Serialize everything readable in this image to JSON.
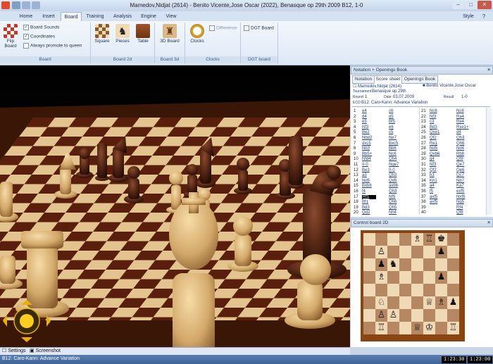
{
  "window": {
    "title": "Mamedov,Nidjat (2614) - Benito Vicente,Jose Oscar (2022), Benasque op 29th 2009  B12, 1-0"
  },
  "tabs": [
    "Home",
    "Insert",
    "Board",
    "Training",
    "Analysis",
    "Engine",
    "View"
  ],
  "active_tab": "Board",
  "style_label": "Style",
  "ribbon": {
    "flip_board": "Flip Board",
    "board_sounds": "Board Sounds",
    "coordinates": "Coordinates",
    "always_promote": "Always promote to queen",
    "group_board": "Board",
    "square": "Square",
    "pieces": "Pieces",
    "table": "Table",
    "group_board2d": "Board 2d",
    "board3d": "3D Board",
    "group_board3d": "Board 3d",
    "clocks": "Clocks",
    "difference": "Difference",
    "group_clocks": "Clocks",
    "dgt_board": "DGT Board",
    "group_dgt": "DGT board"
  },
  "notation_panel": {
    "title": "Notation + Openings Book",
    "subtabs": [
      "Notation",
      "Score sheet",
      "Openings Book"
    ],
    "active_subtab": "Score sheet",
    "white_player": "Mamedov,Nidjat (2614)",
    "black_player": "Benito Vicente,Jose Oscar",
    "tournament_label": "Tournament",
    "tournament": "Benasque op 29th",
    "round_label": "Round",
    "round": "1",
    "date_label": "Date",
    "date": "03.07.2009",
    "result_label": "Result",
    "result": "1-0",
    "eco_label": "ECO",
    "eco": "B12: Caro-Kann: Advance Variation",
    "moves_left": [
      [
        "1",
        "e4",
        "c6"
      ],
      [
        "2",
        "d4",
        "d5"
      ],
      [
        "3",
        "e5",
        "Bf5"
      ],
      [
        "4",
        "Nf3",
        "e6"
      ],
      [
        "5",
        "Be2",
        "c5"
      ],
      [
        "6",
        "Nbd2",
        "Ne7"
      ],
      [
        "7",
        "dxc5",
        "Bxc5"
      ],
      [
        "8",
        "Nb3",
        "Bb6"
      ],
      [
        "9",
        "Bb5+",
        "Nc6"
      ],
      [
        "10",
        "Nfd4",
        "Qh4"
      ],
      [
        "11",
        "0-0",
        "Nge7"
      ],
      [
        "12",
        "Be3",
        "0-0"
      ],
      [
        "13",
        "a3",
        "Qh3"
      ],
      [
        "14",
        "Nd5",
        "Qd5"
      ],
      [
        "15",
        "Bxb6",
        "axb6"
      ],
      [
        "16",
        "f4",
        "Qh3"
      ],
      [
        "17",
        "Rf1",
        "Nf5"
      ],
      [
        "18",
        "Bf1",
        "Qh6"
      ],
      [
        "19",
        "Bd3",
        "Qh5"
      ],
      [
        "20",
        "Qd2",
        "Nh4"
      ]
    ],
    "moves_right": [
      [
        "21",
        "Nc6",
        "Nc6"
      ],
      [
        "22",
        "Nf3",
        "Ra4"
      ],
      [
        "23",
        "c3",
        "Re4"
      ],
      [
        "24",
        "Bd3",
        "Rxe1+"
      ],
      [
        "25",
        "Qxe1",
        "d4"
      ],
      [
        "26",
        "Qf2",
        "Qh3"
      ],
      [
        "27",
        "Re1",
        "Qh6"
      ],
      [
        "28",
        "Nd5",
        "Nd4"
      ],
      [
        "29",
        "Qxb6",
        "Rb8"
      ],
      [
        "30",
        "g4",
        "Qf8"
      ],
      [
        "31",
        "Nf3",
        "Qe7"
      ],
      [
        "32",
        "Qf2",
        "Qe6"
      ],
      [
        "33",
        "h3",
        "Qc7"
      ],
      [
        "34",
        "Kh1",
        "Nb7"
      ],
      [
        "35",
        "a4",
        "Ka7"
      ],
      [
        "36",
        "f5",
        "exf5"
      ],
      [
        "37",
        "axf5",
        "Nxf5"
      ],
      [
        "38",
        "axf5",
        "Ng5"
      ],
      [
        "39",
        "",
        "Rf4"
      ],
      [
        "40",
        "",
        "Qf8"
      ]
    ],
    "highlight_move": "Rf1"
  },
  "control_board": {
    "title": "Control board 2D",
    "pieces": [
      [
        "",
        "",
        "",
        "",
        "♗",
        "♖",
        "♚",
        ""
      ],
      [
        "",
        "♙",
        "",
        "",
        "",
        "",
        "♟",
        ""
      ],
      [
        "",
        "♟",
        "♞",
        "",
        "",
        "",
        "",
        ""
      ],
      [
        "",
        "♗",
        "",
        "",
        "",
        "",
        "♟",
        ""
      ],
      [
        "",
        "",
        "",
        "",
        "",
        "",
        "",
        ""
      ],
      [
        "",
        "♘",
        "",
        "",
        "",
        "♕",
        "♗",
        "♟"
      ],
      [
        "",
        "♙",
        "♙",
        "",
        "",
        "",
        "",
        ""
      ],
      [
        "",
        "♖",
        "",
        "",
        "♕",
        "♔",
        "",
        "♖"
      ]
    ],
    "light_square": "#f0d9b5",
    "dark_square": "#b58863",
    "border_color": "#8b4513"
  },
  "bottom_tabs": {
    "settings": "Settings",
    "screenshot": "Screenshot"
  },
  "status": {
    "opening": "B12: Caro-Kann: Advance Variation",
    "clock_white": "1:23:30",
    "clock_black": "1:23:00"
  },
  "colors": {
    "accent": "#3f6498",
    "ribbon_bg": "#dde8f5"
  }
}
